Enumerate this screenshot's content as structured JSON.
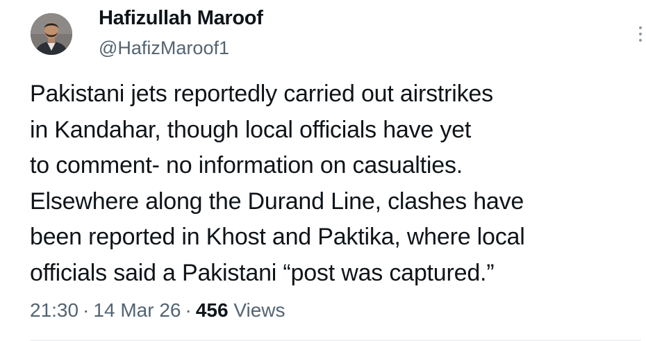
{
  "author": {
    "name": "Hafizullah Maroof",
    "handle": "@HafizMaroof1"
  },
  "tweet": {
    "lines": [
      "Pakistani jets reportedly carried out airstrikes",
      "in Kandahar, though local officials have yet",
      "to comment- no information on casualties.",
      "Elsewhere along the Durand Line, clashes have",
      "been reported in Khost and Paktika, where local",
      "officials said a Pakistani “post was captured.”"
    ]
  },
  "meta": {
    "time": "21:30",
    "date": "14 Mar 26",
    "separator": "·",
    "views_count": "456",
    "views_label": "Views"
  },
  "colors": {
    "text_primary": "#0f1419",
    "text_secondary": "#536471",
    "divider": "#eff3f4"
  },
  "icons": {
    "more": "more-vertical-icon"
  }
}
